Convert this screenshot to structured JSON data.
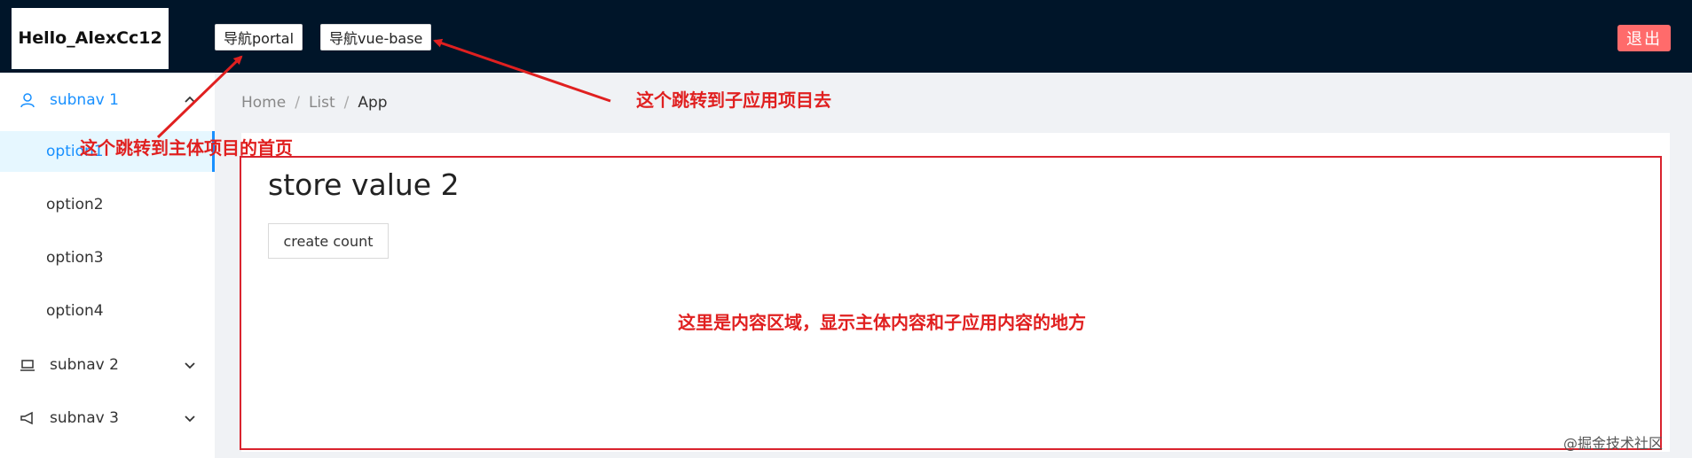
{
  "header": {
    "logo_text": "Hello_AlexCc12",
    "nav_portal_label": "导航portal",
    "nav_vue_label": "导航vue-base",
    "logout_label": "退出",
    "logout_color": "#ff6b6b"
  },
  "sidebar": {
    "subnav1": {
      "label": "subnav 1",
      "icon": "user-icon",
      "expanded": true
    },
    "options": [
      {
        "label": "option1",
        "selected": true
      },
      {
        "label": "option2",
        "selected": false
      },
      {
        "label": "option3",
        "selected": false
      },
      {
        "label": "option4",
        "selected": false
      }
    ],
    "subnav2": {
      "label": "subnav 2",
      "icon": "laptop-icon",
      "expanded": false
    },
    "subnav3": {
      "label": "subnav 3",
      "icon": "notification-icon",
      "expanded": false
    },
    "active_color": "#1890ff"
  },
  "breadcrumb": {
    "items": [
      "Home",
      "List",
      "App"
    ],
    "separator": "/"
  },
  "content": {
    "title": "store value 2",
    "create_button_label": "create count"
  },
  "annotations": {
    "main_project": "这个跳转到主体项目的首页",
    "sub_app": "这个跳转到子应用项目去",
    "content_area": "这里是内容区域，显示主体内容和子应用内容的地方",
    "color": "#e02020"
  },
  "watermark": "@掘金技术社区"
}
